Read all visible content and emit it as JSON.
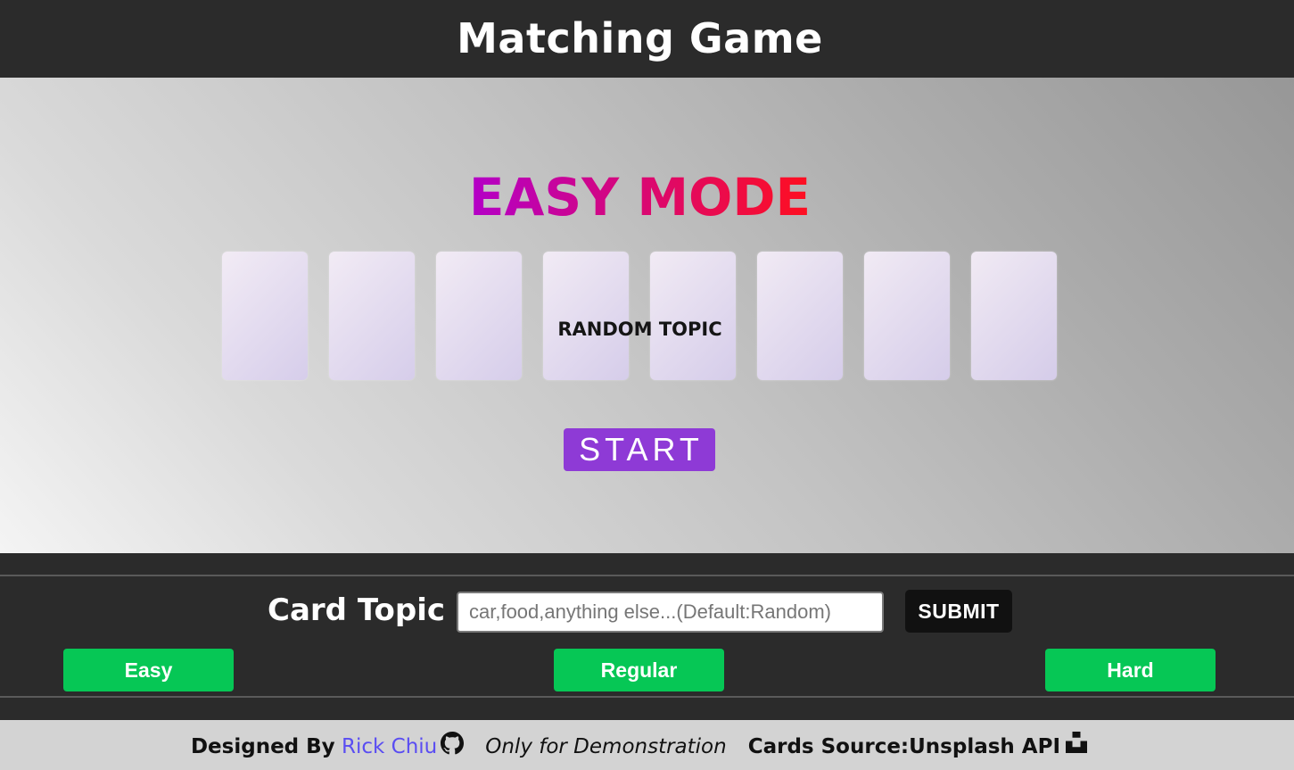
{
  "header": {
    "title": "Matching Game"
  },
  "stage": {
    "mode_title": "EASY MODE",
    "card_count": 8,
    "topic_label": "RANDOM TOPIC",
    "start_label": "START",
    "colors": {
      "accent": "#8e3ad6",
      "title_start": "#b300c8",
      "title_end": "#ff0f1f"
    }
  },
  "controls": {
    "topic_label": "Card Topic",
    "topic_input_value": "",
    "topic_input_placeholder": "car,food,anything else...(Default:Random)",
    "submit_label": "SUBMIT",
    "difficulty": [
      {
        "label": "Easy"
      },
      {
        "label": "Regular"
      },
      {
        "label": "Hard"
      }
    ],
    "colors": {
      "difficulty": "#06c755",
      "submit": "#111111"
    }
  },
  "footer": {
    "designed_by": "Designed By",
    "author": "Rick Chiu",
    "author_icon": "github-icon",
    "note": "Only for Demonstration",
    "source": "Cards Source:Unsplash API",
    "source_icon": "unsplash-icon"
  }
}
